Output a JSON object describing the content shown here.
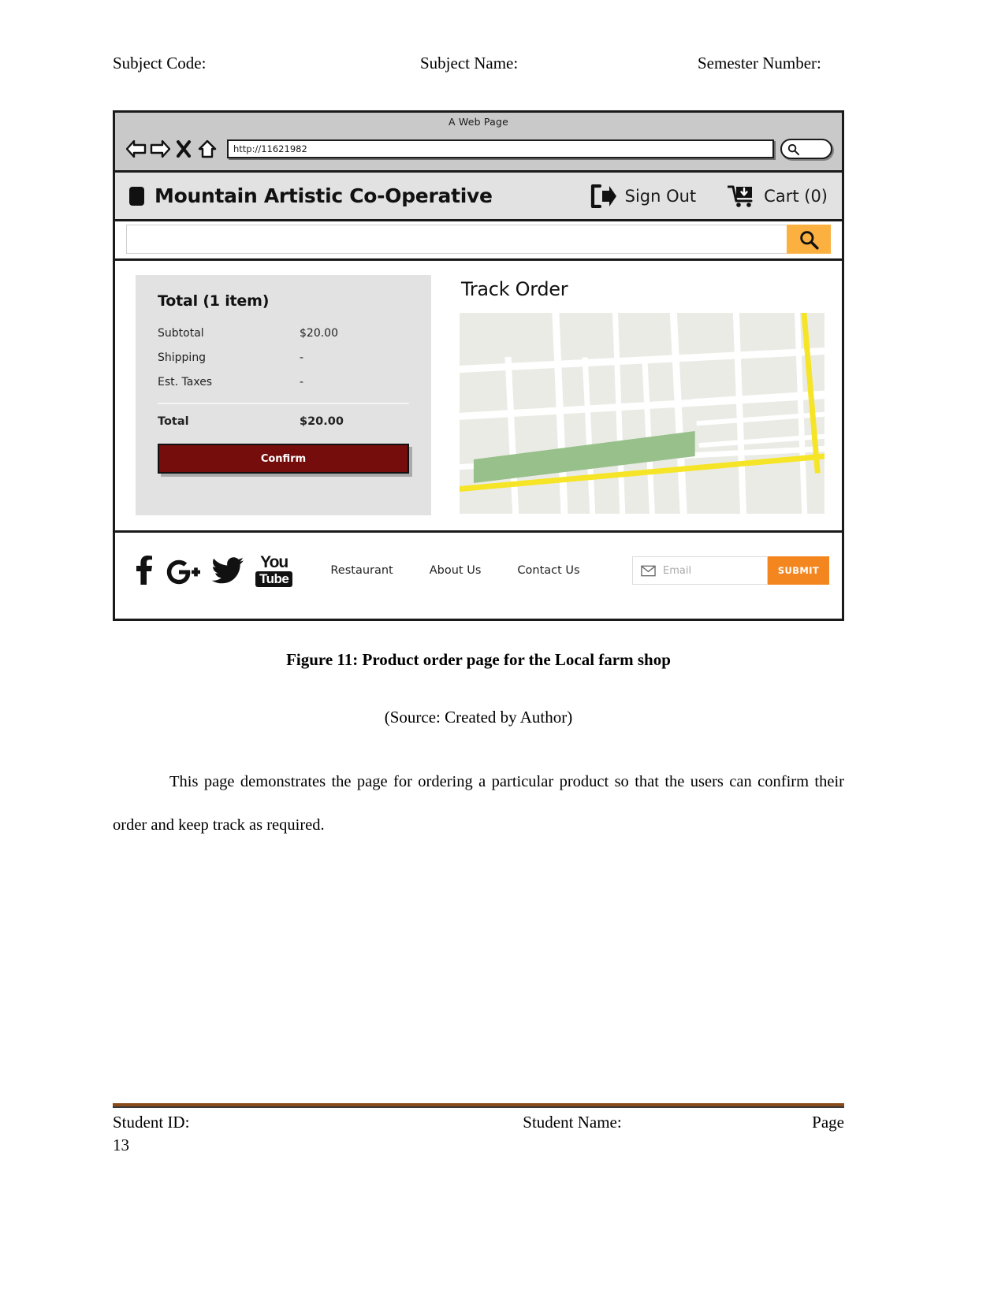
{
  "doc": {
    "header": {
      "subject_code": "Subject Code:",
      "subject_name": "Subject Name:",
      "semester_number": "Semester Number:"
    },
    "figure_caption": "Figure 11: Product order page for the Local farm shop",
    "figure_source": "(Source: Created by Author)",
    "paragraph": "This page demonstrates the page for ordering a particular product so that the users can confirm their order and keep track as required.",
    "footer": {
      "student_id": "Student ID:",
      "student_name": "Student Name:",
      "page_label": "Page",
      "page_number": "13"
    }
  },
  "browser": {
    "window_title": "A Web Page",
    "url": "http://11621982",
    "nav": {
      "back": "back-arrow-icon",
      "forward": "forward-arrow-icon",
      "stop": "close-x-icon",
      "home": "home-icon",
      "search": "search-icon"
    }
  },
  "site": {
    "header": {
      "brand": "Mountain Artistic Co-Operative",
      "sign_out_label": "Sign Out",
      "cart_label": "Cart (0)"
    },
    "search": {
      "value": "",
      "placeholder": "",
      "button_icon": "search-icon",
      "button_color": "#fbb040"
    },
    "order_summary": {
      "title": "Total (1 item)",
      "lines": [
        {
          "label": "Subtotal",
          "value": "$20.00"
        },
        {
          "label": "Shipping",
          "value": "-"
        },
        {
          "label": "Est. Taxes",
          "value": "-"
        }
      ],
      "total_label": "Total",
      "total_value": "$20.00",
      "confirm_label": "Confirm",
      "confirm_color": "#750d0d",
      "panel_color": "#e2e2e2"
    },
    "track_order": {
      "title": "Track Order",
      "map": {
        "background_color": "#ebebe6",
        "street_color": "#ffffff",
        "highway_color": "#f5e526",
        "park_color": "#97c08a"
      }
    },
    "footer": {
      "socials": [
        {
          "name": "facebook-icon",
          "label": "f"
        },
        {
          "name": "google-plus-icon",
          "label": "G+"
        },
        {
          "name": "twitter-icon",
          "label": ""
        },
        {
          "name": "youtube-icon",
          "label_top": "You",
          "label_bottom": "Tube"
        }
      ],
      "links": [
        "Restaurant",
        "About Us",
        "Contact Us"
      ],
      "email_placeholder": "Email",
      "email_value": "",
      "submit_label": "SUBMIT",
      "submit_color": "#f4861f"
    }
  }
}
